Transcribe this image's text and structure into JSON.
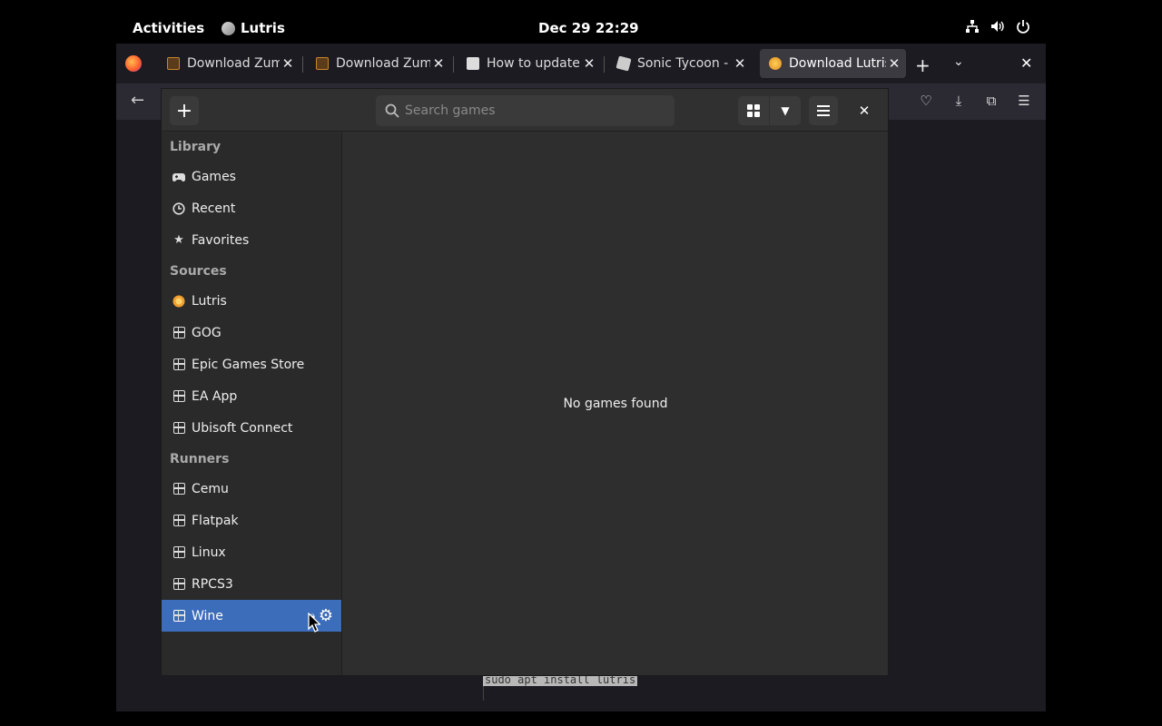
{
  "topbar": {
    "activities": "Activities",
    "app_name": "Lutris",
    "clock": "Dec 29  22:29"
  },
  "firefox": {
    "tabs": [
      {
        "title": "Download Zuma",
        "favicon": "r-icon"
      },
      {
        "title": "Download Zuma",
        "favicon": "r-icon"
      },
      {
        "title": "How to update P",
        "favicon": "playstation-icon"
      },
      {
        "title": "Sonic Tycoon - R",
        "favicon": "roblox-icon"
      },
      {
        "title": "Download Lutris",
        "favicon": "lutris-icon",
        "active": true
      }
    ],
    "code_text": "sudo apt install lutris"
  },
  "lutris": {
    "search_placeholder": "Search games",
    "empty_message": "No games found",
    "sidebar": {
      "library_header": "Library",
      "library": [
        {
          "label": "Games",
          "icon": "gamepad-icon"
        },
        {
          "label": "Recent",
          "icon": "clock-icon"
        },
        {
          "label": "Favorites",
          "icon": "star-icon"
        }
      ],
      "sources_header": "Sources",
      "sources": [
        {
          "label": "Lutris",
          "icon": "lutris-icon"
        },
        {
          "label": "GOG",
          "icon": "package-icon"
        },
        {
          "label": "Epic Games Store",
          "icon": "package-icon"
        },
        {
          "label": "EA App",
          "icon": "package-icon"
        },
        {
          "label": "Ubisoft Connect",
          "icon": "package-icon"
        }
      ],
      "runners_header": "Runners",
      "runners": [
        {
          "label": "Cemu",
          "icon": "package-icon"
        },
        {
          "label": "Flatpak",
          "icon": "package-icon"
        },
        {
          "label": "Linux",
          "icon": "package-icon"
        },
        {
          "label": "RPCS3",
          "icon": "package-icon"
        },
        {
          "label": "Wine",
          "icon": "package-icon",
          "selected": true
        }
      ]
    }
  }
}
